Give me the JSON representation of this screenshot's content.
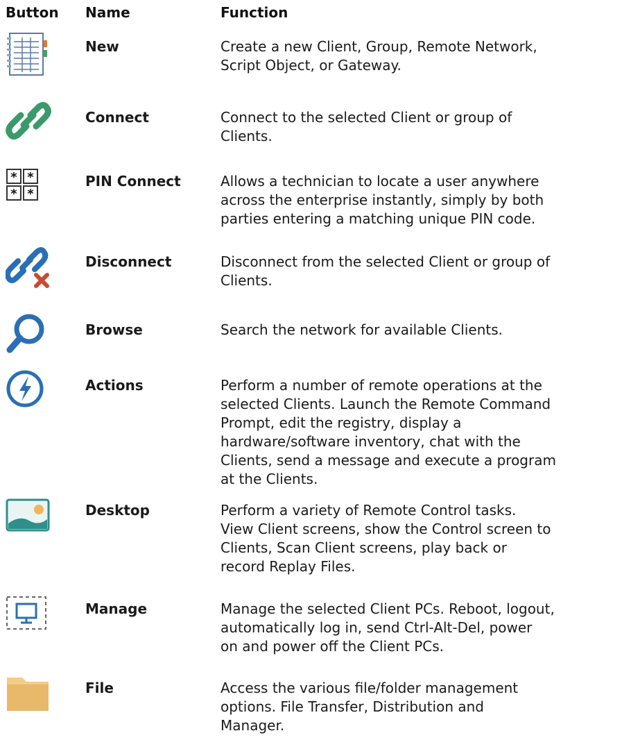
{
  "headers": {
    "button": "Button",
    "name": "Name",
    "function": "Function"
  },
  "rows": [
    {
      "icon": "address-book-icon",
      "name": "New",
      "function_lines": [
        "Create a new Client, Group, Remote Network,",
        "Script Object, or Gateway."
      ]
    },
    {
      "icon": "link-chain-icon",
      "name": "Connect",
      "function_lines": [
        "Connect to the selected Client or group of",
        "Clients."
      ]
    },
    {
      "icon": "pin-grid-icon",
      "name": "PIN Connect",
      "function_lines": [
        "Allows a technician to locate a user anywhere",
        "across the enterprise instantly, simply by both",
        "parties entering a matching unique PIN code."
      ]
    },
    {
      "icon": "broken-link-icon",
      "name": "Disconnect",
      "function_lines": [
        "Disconnect from the selected Client or group of",
        "Clients."
      ]
    },
    {
      "icon": "magnifier-icon",
      "name": "Browse",
      "function_lines": [
        "Search the network for available Clients."
      ]
    },
    {
      "icon": "lightning-circle-icon",
      "name": "Actions",
      "function_lines": [
        "Perform a number of remote operations at the",
        "selected Clients. Launch the Remote Command",
        "Prompt, edit the registry, display a",
        "hardware/software inventory, chat with the",
        "Clients, send a message and execute a program",
        "at the Clients."
      ]
    },
    {
      "icon": "landscape-picture-icon",
      "name": "Desktop",
      "function_lines": [
        "Perform a variety of Remote Control tasks.",
        "View Client screens, show the Control screen to",
        "Clients, Scan Client screens, play back or",
        "record Replay Files."
      ]
    },
    {
      "icon": "monitor-dashed-icon",
      "name": "Manage",
      "function_lines": [
        "Manage the selected Client PCs. Reboot, logout,",
        "automatically log in, send Ctrl-Alt-Del, power",
        "on and power off the Client PCs."
      ]
    },
    {
      "icon": "folder-icon",
      "name": "File",
      "function_lines": [
        "Access the various file/folder management",
        "options. File Transfer, Distribution and",
        "Manager."
      ]
    }
  ],
  "colors": {
    "link_green": "#3a9a6a",
    "icon_blue": "#2a6fb5",
    "cross_red": "#c84a30",
    "folder_tan": "#e8b96a",
    "picture_teal": "#2f8f8a",
    "picture_sun": "#f0b45a"
  }
}
